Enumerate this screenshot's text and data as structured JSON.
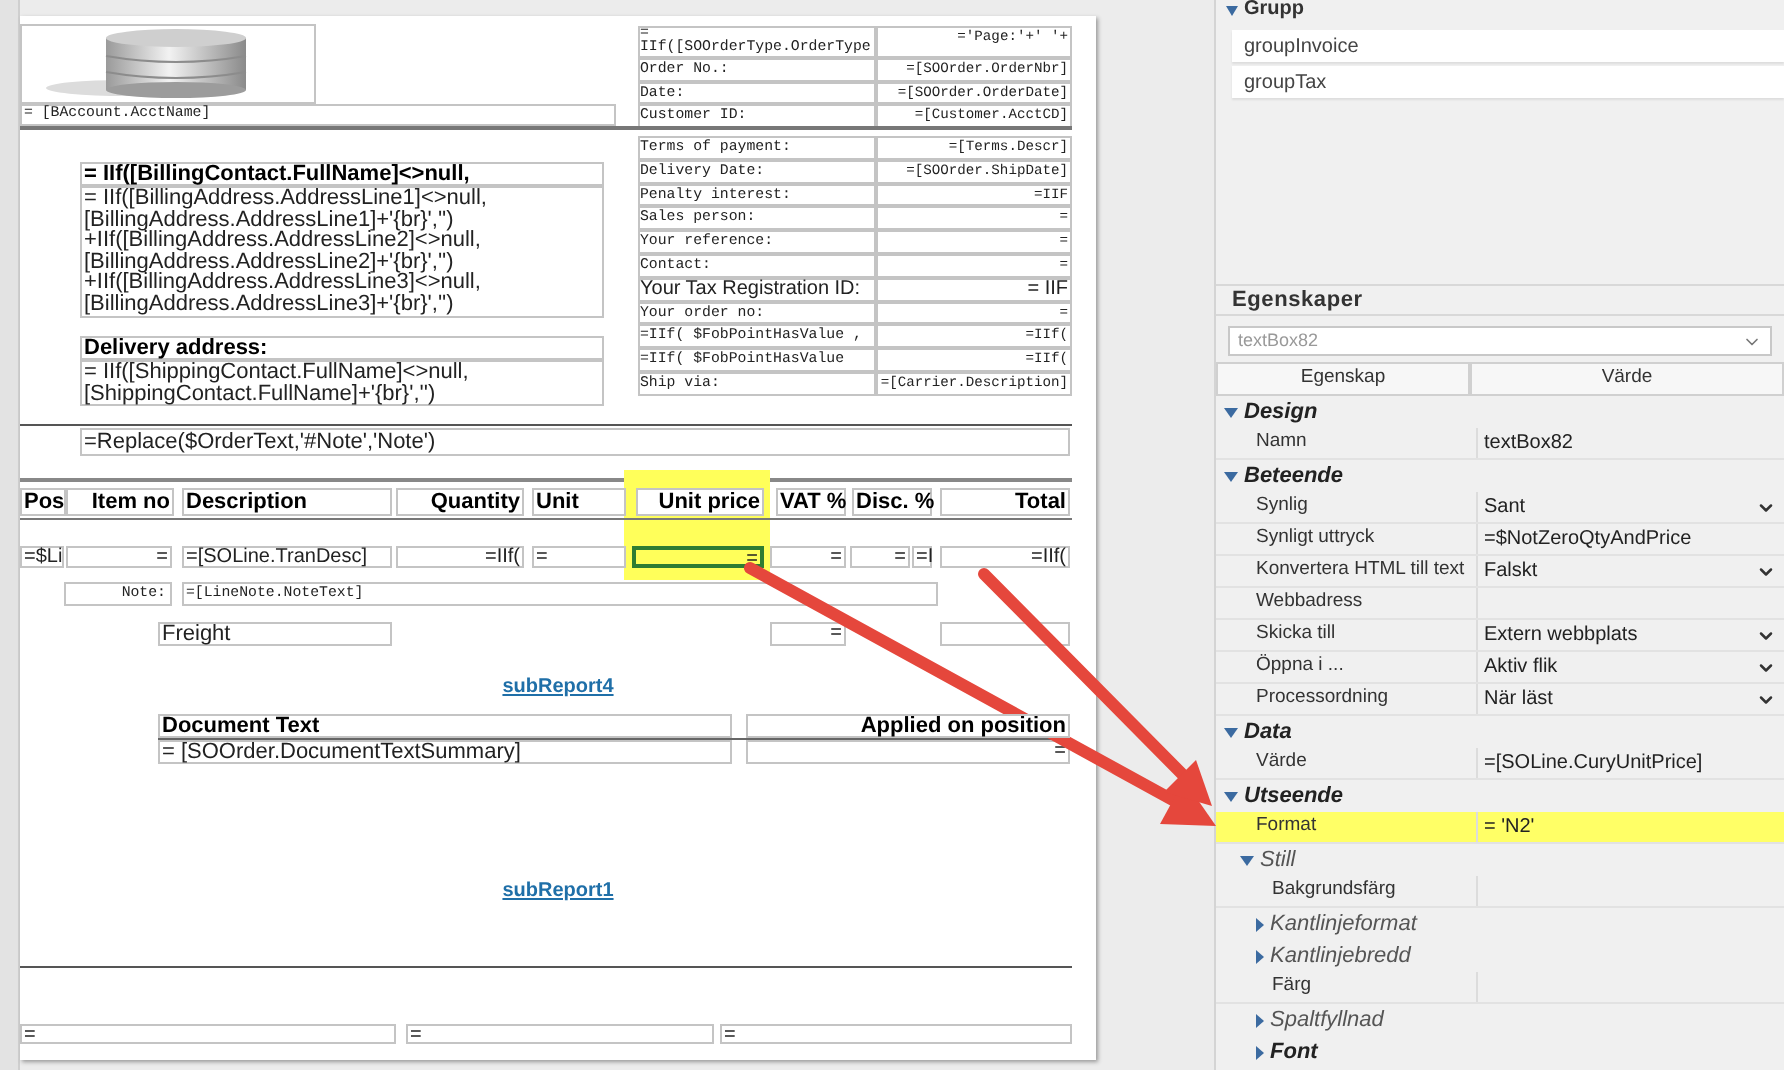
{
  "report": {
    "acct_name": "= [BAccount.AcctName]",
    "order_info": [
      {
        "kind": "two-line",
        "label": "=\nIIf([SOOrderType.OrderType",
        "value": "='Page:'+' '+"
      },
      {
        "kind": "mono",
        "label": "Order No.:",
        "value": "=[SOOrder.OrderNbr]"
      },
      {
        "kind": "mono",
        "label": "Date:",
        "value": "=[SOOrder.OrderDate]"
      },
      {
        "kind": "mono",
        "label": "Customer ID:",
        "value": "=[Customer.AcctCD]"
      }
    ],
    "terms_info": [
      {
        "kind": "mono",
        "label": "Terms of payment:",
        "value": "=[Terms.Descr]"
      },
      {
        "kind": "mono",
        "label": "Delivery Date:",
        "value": "=[SOOrder.ShipDate]"
      },
      {
        "kind": "mono",
        "label": "Penalty interest:",
        "value": "=IIF"
      },
      {
        "kind": "mono",
        "label": "Sales person:",
        "value": "="
      },
      {
        "kind": "mono",
        "label": "Your reference:",
        "value": "="
      },
      {
        "kind": "mono",
        "label": "Contact:",
        "value": "="
      },
      {
        "kind": "large",
        "label": "Your Tax Registration ID:",
        "value": "= IIF"
      },
      {
        "kind": "mono",
        "label": "Your order no:",
        "value": "="
      },
      {
        "kind": "mono",
        "label": "=IIf( $FobPointHasValue ,",
        "value": "=IIf("
      },
      {
        "kind": "mono",
        "label": "=IIf( $FobPointHasValue",
        "value": "=IIf("
      },
      {
        "kind": "mono",
        "label": "Ship via:",
        "value": "=[Carrier.Description]"
      }
    ],
    "billing_title": "= IIf([BillingContact.FullName]<>null,",
    "billing_text": "= IIf([BillingAddress.AddressLine1]<>null,\n[BillingAddress.AddressLine1]+'{br}','')\n+IIf([BillingAddress.AddressLine2]<>null,\n[BillingAddress.AddressLine2]+'{br}','')\n+IIf([BillingAddress.AddressLine3]<>null,\n[BillingAddress.AddressLine3]+'{br}','')",
    "delivery_title": "Delivery address:",
    "delivery_text": "= IIf([ShippingContact.FullName]<>null,\n[ShippingContact.FullName]+'{br}','')",
    "order_text": "=Replace($OrderText,'#Note','Note')",
    "columns": [
      {
        "label": "Pos",
        "highlighted": false
      },
      {
        "label": "Item no",
        "highlighted": false
      },
      {
        "label": "Description",
        "highlighted": false
      },
      {
        "label": "Quantity",
        "highlighted": false
      },
      {
        "label": "Unit",
        "highlighted": false
      },
      {
        "label": "Unit price",
        "highlighted": true
      },
      {
        "label": "VAT %",
        "highlighted": false
      },
      {
        "label": "Disc. %",
        "highlighted": false
      },
      {
        "label": "Total",
        "highlighted": false
      }
    ],
    "detail_cells": [
      {
        "text": "=$Li",
        "selected": false
      },
      {
        "text": "=",
        "selected": false
      },
      {
        "text": "=[SOLine.TranDesc]",
        "selected": false
      },
      {
        "text": "=IIf(",
        "selected": false
      },
      {
        "text": "=",
        "selected": false
      },
      {
        "text": "=",
        "selected": true
      },
      {
        "text": "=",
        "selected": false
      },
      {
        "text": "=",
        "selected": false
      },
      {
        "text": "=I",
        "selected": false
      },
      {
        "text": "=IIf(",
        "selected": false
      }
    ],
    "note_label": "Note:",
    "note_value": "=[LineNote.NoteText]",
    "freight_label": "Freight",
    "freight_value": "=",
    "subreport_a": "subReport4",
    "doc_text_header": "Document Text",
    "applied_header": "Applied on position",
    "doc_text_value": "= [SOOrder.DocumentTextSummary]",
    "applied_value": "=",
    "subreport_b": "subReport1",
    "footer_fields": [
      "=",
      "=",
      "="
    ]
  },
  "groups_panel": {
    "title": "Grupp",
    "items": [
      "groupInvoice",
      "groupTax"
    ]
  },
  "properties_panel": {
    "title": "Egenskaper",
    "selected_object": "textBox82",
    "columns": [
      "Egenskap",
      "Värde"
    ],
    "sections": [
      {
        "kind": "section",
        "title": "Design",
        "expanded": true,
        "children": [
          {
            "kind": "property",
            "name": "Namn",
            "value": "textBox82",
            "dropdown": false,
            "highlighted": false
          }
        ]
      },
      {
        "kind": "section",
        "title": "Beteende",
        "expanded": true,
        "children": [
          {
            "kind": "property",
            "name": "Synlig",
            "value": "Sant",
            "dropdown": true,
            "highlighted": false
          },
          {
            "kind": "property",
            "name": "Synligt uttryck",
            "value": "=$NotZeroQtyAndPrice",
            "dropdown": false,
            "highlighted": false
          },
          {
            "kind": "property",
            "name": "Konvertera HTML till text",
            "value": "Falskt",
            "dropdown": true,
            "highlighted": false
          },
          {
            "kind": "property",
            "name": "Webbadress",
            "dropdown": false,
            "highlighted": false
          },
          {
            "kind": "property",
            "name": "Skicka till",
            "value": "Extern webbplats",
            "dropdown": true,
            "highlighted": false
          },
          {
            "kind": "property",
            "name": "Öppna i ...",
            "value": "Aktiv flik",
            "dropdown": true,
            "highlighted": false
          },
          {
            "kind": "property",
            "name": "Processordning",
            "value": "När läst",
            "dropdown": true,
            "highlighted": false
          }
        ]
      },
      {
        "kind": "section",
        "title": "Data",
        "expanded": true,
        "children": [
          {
            "kind": "property",
            "name": "Värde",
            "value": "=[SOLine.CuryUnitPrice]",
            "dropdown": false,
            "highlighted": false
          }
        ]
      },
      {
        "kind": "section",
        "title": "Utseende",
        "expanded": true,
        "children": [
          {
            "kind": "property",
            "name": "Format",
            "value": "= 'N2'",
            "dropdown": false,
            "highlighted": true
          },
          {
            "kind": "group",
            "title": "Still",
            "expanded": true,
            "children": [
              {
                "kind": "property",
                "name": "Bakgrundsfärg",
                "dropdown": false,
                "highlighted": false
              },
              {
                "kind": "group",
                "title": "Kantlinjeformat",
                "expanded": false
              },
              {
                "kind": "group",
                "title": "Kantlinjebredd",
                "expanded": false
              },
              {
                "kind": "property",
                "name": "Färg",
                "dropdown": false,
                "highlighted": false
              },
              {
                "kind": "group",
                "title": "Spaltfyllnad",
                "expanded": false
              },
              {
                "kind": "section",
                "title": "Font",
                "expanded": false
              }
            ]
          }
        ]
      }
    ]
  }
}
